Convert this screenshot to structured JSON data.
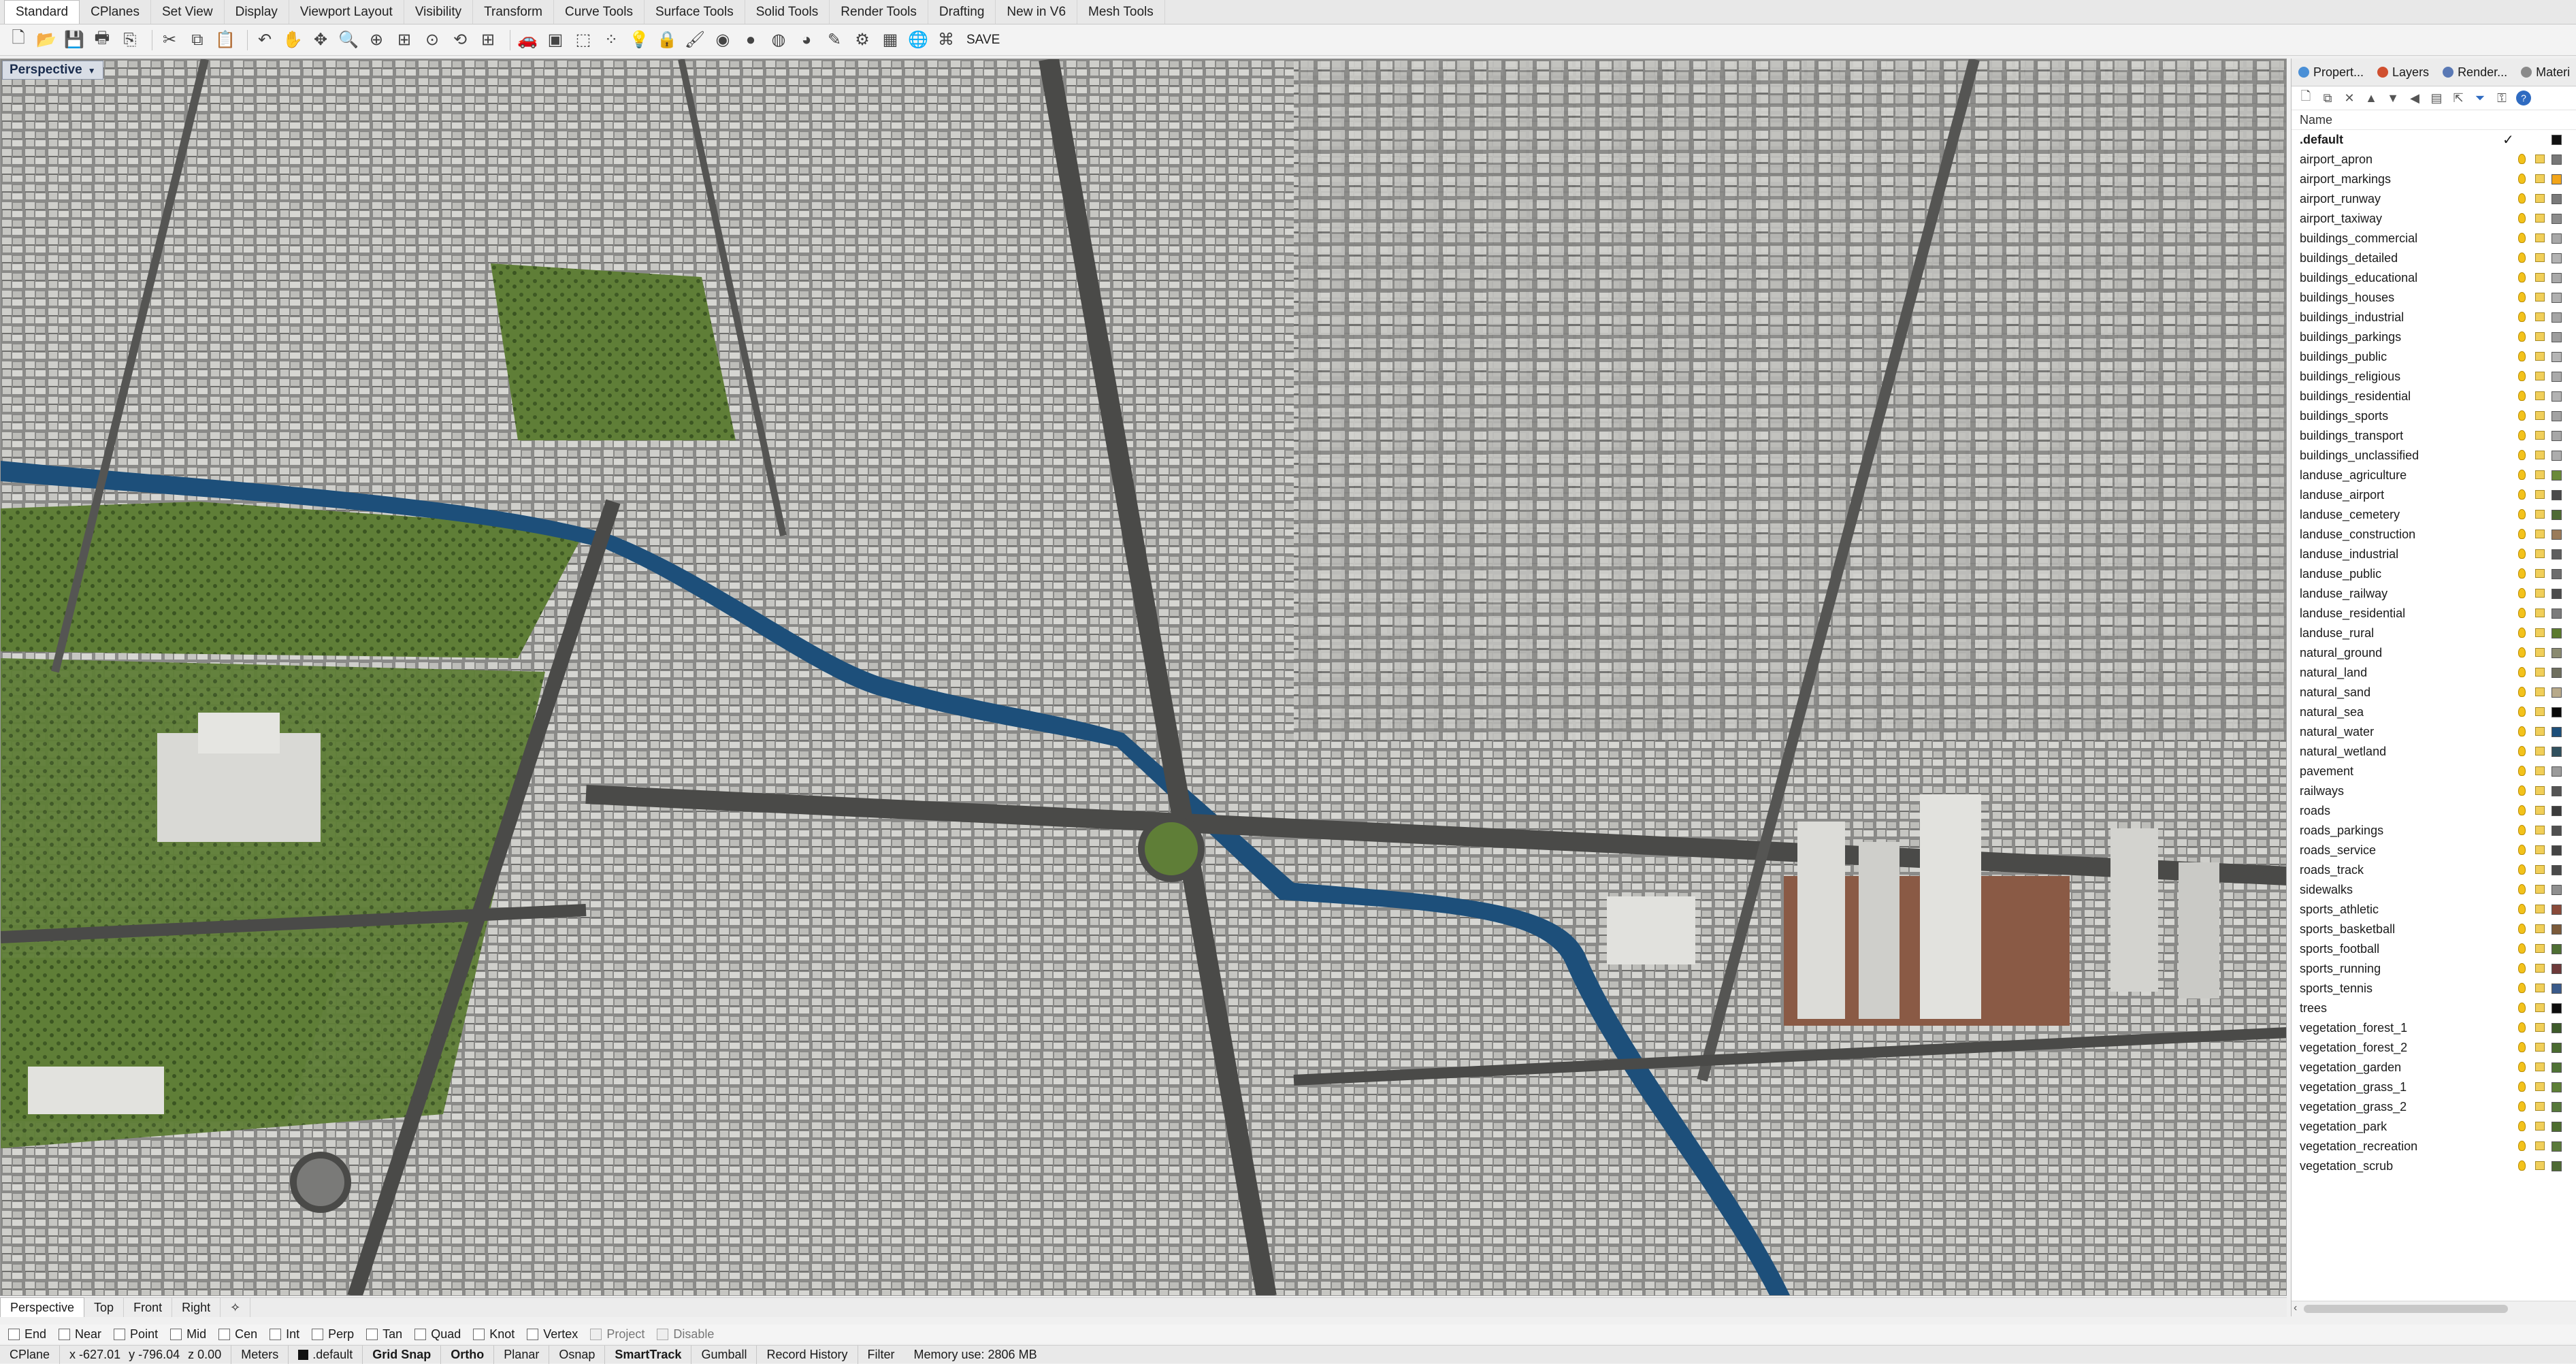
{
  "menu_tabs": [
    "Standard",
    "CPlanes",
    "Set View",
    "Display",
    "Viewport Layout",
    "Visibility",
    "Transform",
    "Curve Tools",
    "Surface Tools",
    "Solid Tools",
    "Render Tools",
    "Drafting",
    "New in V6",
    "Mesh Tools"
  ],
  "toolbar": {
    "save_label": "SAVE",
    "icons": [
      "new-file-icon",
      "open-file-icon",
      "save-icon",
      "print-icon",
      "import-icon",
      "cut-icon",
      "copy-icon",
      "paste-icon",
      "undo-icon",
      "pan-icon",
      "move-view-icon",
      "zoom-icon",
      "zoom-window-icon",
      "zoom-extents-icon",
      "zoom-selected-icon",
      "rotate-view-icon",
      "four-viewports-icon",
      "car-icon",
      "blocks-icon",
      "select-icon",
      "points-icon",
      "lightbulb-icon",
      "lock-icon",
      "paint-icon",
      "color-wheel-icon",
      "sphere-icon",
      "shaded-sphere-icon",
      "render-sphere-icon",
      "eyedropper-icon",
      "settings-gears-icon",
      "grid-icon",
      "globe-icon",
      "script-icon"
    ]
  },
  "viewport": {
    "title": "Perspective"
  },
  "panel": {
    "tabs": [
      {
        "label": "Propert...",
        "icon": "properties-icon",
        "color": "#4a8fd6"
      },
      {
        "label": "Layers",
        "icon": "layers-icon",
        "color": "#d04f2f"
      },
      {
        "label": "Render...",
        "icon": "render-icon",
        "color": "#5a79b5"
      },
      {
        "label": "Materi",
        "icon": "materials-icon",
        "color": "#8a8a8a"
      }
    ],
    "tools": [
      "new-layer-icon",
      "new-sublayer-icon",
      "delete-icon",
      "move-up-icon",
      "move-down-icon",
      "move-left-icon",
      "layer-properties-icon",
      "move-to-parent-icon",
      "filter-icon",
      "key-icon",
      "help-icon"
    ],
    "column_header": "Name",
    "layers": [
      {
        "name": ".default",
        "color": "#111111",
        "current": true
      },
      {
        "name": "airport_apron",
        "color": "#777777"
      },
      {
        "name": "airport_markings",
        "color": "#f2a51a"
      },
      {
        "name": "airport_runway",
        "color": "#7a7a7a"
      },
      {
        "name": "airport_taxiway",
        "color": "#8c8c8c"
      },
      {
        "name": "buildings_commercial",
        "color": "#a8a8a8"
      },
      {
        "name": "buildings_detailed",
        "color": "#b3b3b3"
      },
      {
        "name": "buildings_educational",
        "color": "#a9a9a9"
      },
      {
        "name": "buildings_houses",
        "color": "#b0b0b0"
      },
      {
        "name": "buildings_industrial",
        "color": "#a5a5a5"
      },
      {
        "name": "buildings_parkings",
        "color": "#9d9d9d"
      },
      {
        "name": "buildings_public",
        "color": "#b5b5b5"
      },
      {
        "name": "buildings_religious",
        "color": "#aaaaaa"
      },
      {
        "name": "buildings_residential",
        "color": "#b2b2b2"
      },
      {
        "name": "buildings_sports",
        "color": "#a2a2a2"
      },
      {
        "name": "buildings_transport",
        "color": "#a7a7a7"
      },
      {
        "name": "buildings_unclassified",
        "color": "#adadad"
      },
      {
        "name": "landuse_agriculture",
        "color": "#6a8a3a"
      },
      {
        "name": "landuse_airport",
        "color": "#4a4a4a"
      },
      {
        "name": "landuse_cemetery",
        "color": "#4f6b35"
      },
      {
        "name": "landuse_construction",
        "color": "#9a7b5a"
      },
      {
        "name": "landuse_industrial",
        "color": "#5f5f5f"
      },
      {
        "name": "landuse_public",
        "color": "#6d6d6d"
      },
      {
        "name": "landuse_railway",
        "color": "#4d4d4d"
      },
      {
        "name": "landuse_residential",
        "color": "#7b7b7b"
      },
      {
        "name": "landuse_rural",
        "color": "#5c7a2e"
      },
      {
        "name": "natural_ground",
        "color": "#8a8a70"
      },
      {
        "name": "natural_land",
        "color": "#6f6f5f"
      },
      {
        "name": "natural_sand",
        "color": "#b7a98a"
      },
      {
        "name": "natural_sea",
        "color": "#0a0a0a"
      },
      {
        "name": "natural_water",
        "color": "#1d4f7a"
      },
      {
        "name": "natural_wetland",
        "color": "#31515f"
      },
      {
        "name": "pavement",
        "color": "#9b9b9b"
      },
      {
        "name": "railways",
        "color": "#555555"
      },
      {
        "name": "roads",
        "color": "#3c3c3c"
      },
      {
        "name": "roads_parkings",
        "color": "#505050"
      },
      {
        "name": "roads_service",
        "color": "#444444"
      },
      {
        "name": "roads_track",
        "color": "#4a4a4a"
      },
      {
        "name": "sidewalks",
        "color": "#8f8f8f"
      },
      {
        "name": "sports_athletic",
        "color": "#8a4a3a"
      },
      {
        "name": "sports_basketball",
        "color": "#7b5a3a"
      },
      {
        "name": "sports_football",
        "color": "#4e6f34"
      },
      {
        "name": "sports_running",
        "color": "#6e3a3a"
      },
      {
        "name": "sports_tennis",
        "color": "#3a5a8a"
      },
      {
        "name": "trees",
        "color": "#0c0c0c"
      },
      {
        "name": "vegetation_forest_1",
        "color": "#3d5a2a"
      },
      {
        "name": "vegetation_forest_2",
        "color": "#4a6a30"
      },
      {
        "name": "vegetation_garden",
        "color": "#4f7235"
      },
      {
        "name": "vegetation_grass_1",
        "color": "#5d7f36"
      },
      {
        "name": "vegetation_grass_2",
        "color": "#56783a"
      },
      {
        "name": "vegetation_park",
        "color": "#4d6d2f"
      },
      {
        "name": "vegetation_recreation",
        "color": "#5a7a3a"
      },
      {
        "name": "vegetation_scrub",
        "color": "#4e6a34"
      }
    ]
  },
  "viewport_tabs": [
    "Perspective",
    "Top",
    "Front",
    "Right"
  ],
  "osnaps": [
    {
      "label": "End",
      "enabled": true
    },
    {
      "label": "Near",
      "enabled": true
    },
    {
      "label": "Point",
      "enabled": true
    },
    {
      "label": "Mid",
      "enabled": true
    },
    {
      "label": "Cen",
      "enabled": true
    },
    {
      "label": "Int",
      "enabled": true
    },
    {
      "label": "Perp",
      "enabled": true
    },
    {
      "label": "Tan",
      "enabled": true
    },
    {
      "label": "Quad",
      "enabled": true
    },
    {
      "label": "Knot",
      "enabled": true
    },
    {
      "label": "Vertex",
      "enabled": true
    },
    {
      "label": "Project",
      "enabled": false
    },
    {
      "label": "Disable",
      "enabled": false
    }
  ],
  "status": {
    "cplane": "CPlane",
    "x": "x -627.01",
    "y": "y -796.04",
    "z": "z 0.00",
    "units": "Meters",
    "layer": ".default",
    "grid_snap": "Grid Snap",
    "ortho": "Ortho",
    "planar": "Planar",
    "osnap": "Osnap",
    "smarttrack": "SmartTrack",
    "gumball": "Gumball",
    "record_history": "Record History",
    "filter": "Filter",
    "memory": "Memory use: 2806 MB"
  }
}
